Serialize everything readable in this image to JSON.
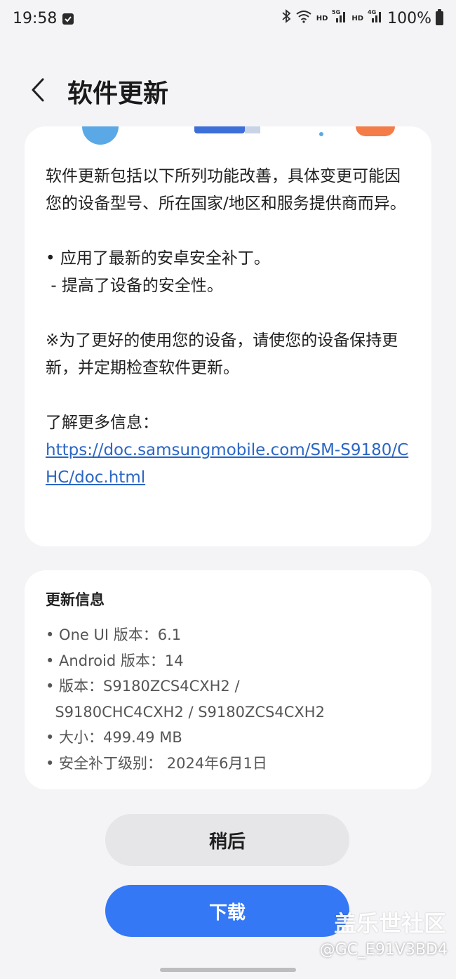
{
  "status_bar": {
    "time": "19:58",
    "icons": [
      "checkbox-icon",
      "bluetooth-icon",
      "wifi-icon",
      "signal-5g-icon",
      "signal-4g-icon",
      "battery-icon"
    ],
    "hd1": "HD",
    "hd2": "HD",
    "net1": "5G",
    "net2": "4G",
    "battery": "100%"
  },
  "header": {
    "back_icon": "chevron-left-icon",
    "title": "软件更新"
  },
  "notes": {
    "para1": "软件更新包括以下所列功能改善，具体变更可能因您的设备型号、所在国家/地区和服务提供商而异。",
    "bullet1": "• 应用了最新的安卓安全补丁。",
    "bullet1_sub": " - 提高了设备的安全性。",
    "para2": "※为了更好的使用您的设备，请使您的设备保持更新，并定期检查软件更新。",
    "more_label": "了解更多信息：",
    "link": "https://doc.samsungmobile.com/SM-S9180/CHC/doc.html"
  },
  "update_info": {
    "title": "更新信息",
    "items": [
      "• One UI 版本：6.1",
      "• Android 版本：14",
      "• 版本：S9180ZCS4CXH2 /",
      "  S9180CHC4CXH2 / S9180ZCS4CXH2",
      "• 大小：499.49 MB",
      "• 安全补丁级别： 2024年6月1日"
    ]
  },
  "buttons": {
    "later": "稍后",
    "download": "下载"
  },
  "watermark": {
    "brand": "盖乐世社区",
    "user": "@GC_E91V3BD4"
  },
  "colors": {
    "background": "#f4f4f6",
    "card": "#ffffff",
    "primary_button": "#3478f6",
    "secondary_button": "#e6e6e9",
    "link": "#2b66c4"
  }
}
